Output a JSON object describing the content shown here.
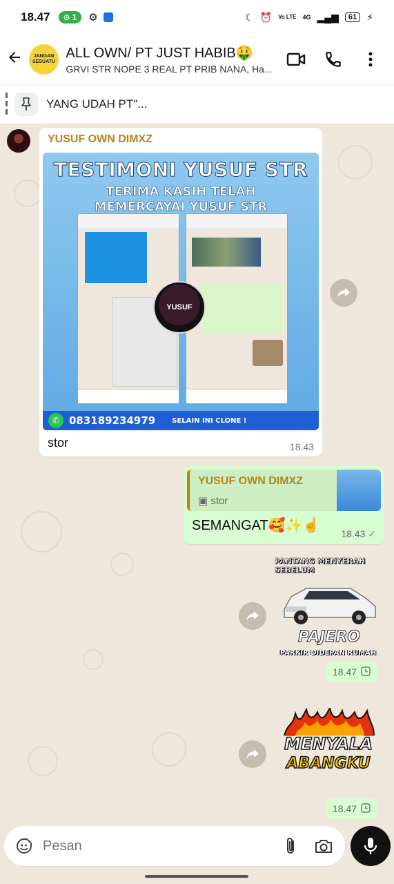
{
  "status_bar": {
    "time": "18.47",
    "hotspot_count": "1",
    "battery": "61",
    "network": "4G",
    "volte": "Vo LTE"
  },
  "header": {
    "title": "ALL OWN/ PT JUST HABIB🤑",
    "subtitle": "GRVI STR NOPE 3 REAL PT PRIB NANA, Ha...",
    "avatar_text": "JANGAN SESUATU"
  },
  "pinned": {
    "text": "YANG UDAH PT\"..."
  },
  "messages": {
    "incoming": {
      "sender": "YUSUF OWN DIMXZ",
      "image": {
        "title": "TESTIMONI YUSUF STR",
        "subtitle_line1": "TERIMA KASIH TELAH",
        "subtitle_line2": "MEMERCAYAI YUSUF STR",
        "logo_text": "YUSUF",
        "phone": "083189234979",
        "note": "SELAIN INI CLONE !"
      },
      "caption": "stor",
      "time": "18.43"
    },
    "outgoing_reply": {
      "quoted_sender": "YUSUF OWN DIMXZ",
      "quoted_text": "stor",
      "text": "SEMANGAT🥰✨☝️",
      "time": "18.43",
      "status_icon": "✓"
    },
    "sticker_pajero": {
      "top_text": "PANTANG MENYERAH SEBELUM",
      "word": "PAJERO",
      "bottom_text": "PARKIR DIDEPAN RUMAH",
      "time": "18.47"
    },
    "sticker_menyala": {
      "line1": "MENYALA",
      "line2": "ABANGKU",
      "time": "18.47"
    }
  },
  "input": {
    "placeholder": "Pesan"
  },
  "colors": {
    "chat_bg": "#efe7dc",
    "outgoing_bubble": "#d9fdd3",
    "sender_name": "#b5851b"
  }
}
